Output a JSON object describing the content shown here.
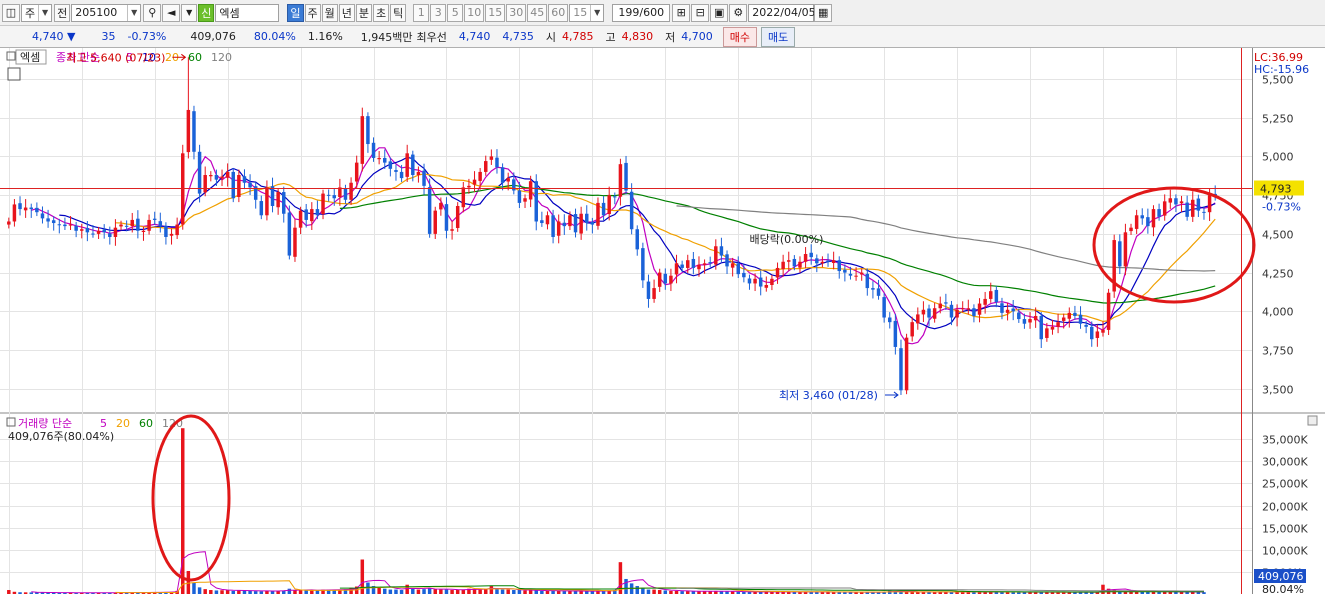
{
  "toolbar": {
    "period_unit": "주",
    "prev_label": "전",
    "stock_code": "205100",
    "stock_badge": "신",
    "stock_name": "엑셈",
    "period_tabs": [
      "일",
      "주",
      "월",
      "년",
      "분",
      "초",
      "틱"
    ],
    "selected_tab": "일",
    "intervals": [
      "1",
      "3",
      "5",
      "10",
      "15",
      "30",
      "45",
      "60"
    ],
    "interval_value": "15",
    "count_display": "199/600",
    "date": "2022/04/05"
  },
  "quote": {
    "price": "4,740",
    "change": "35",
    "change_pct": "-0.73%",
    "volume": "409,076",
    "volume_ratio": "80.04%",
    "turnover": "1.16%",
    "amount": "1,945백만",
    "best_label": "최우선",
    "best_ask": "4,740",
    "best_bid": "4,735",
    "open_label": "시",
    "open": "4,785",
    "high_label": "고",
    "high": "4,830",
    "low_label": "저",
    "low": "4,700",
    "buy_label": "매수",
    "sell_label": "매도"
  },
  "chart_data": {
    "type": "candlestick",
    "price_panel": {
      "indicator_name": "엑셈",
      "legend": {
        "label": "종가 단순",
        "periods": [
          "5",
          "10",
          "20",
          "60",
          "120"
        ],
        "colors": [
          "#c000c0",
          "#0000c0",
          "#f0a000",
          "#008000",
          "#808080"
        ]
      },
      "ylim": [
        3350,
        5700
      ],
      "yticks": [
        "5,500",
        "5,250",
        "5,000",
        "4,750",
        "4,500",
        "4,250",
        "4,000",
        "3,750",
        "3,500"
      ],
      "high_note": "최고 5,640 (07/23)",
      "low_note": "최저 3,460 (01/28)",
      "dividend_note": "배당락(0.00%)",
      "lc_label": "LC:36.99",
      "hc_label": "HC:-15.96",
      "current_price_label": "4,793",
      "current_change_label": "-0.73%",
      "reference_price": 4793,
      "candle_up_color": "#e8141c",
      "candle_down_color": "#1a62d8"
    },
    "volume_panel": {
      "legend": {
        "label": "거래량 단순",
        "periods": [
          "5",
          "20",
          "60",
          "120"
        ],
        "colors": [
          "#c000c0",
          "#f0a000",
          "#008000",
          "#808080"
        ]
      },
      "info": "409,076주(80.04%)",
      "yticks": [
        "35,000K",
        "30,000K",
        "25,000K",
        "20,000K",
        "15,000K",
        "10,000K",
        "5,000K"
      ],
      "ylim_k": [
        0,
        38000
      ],
      "current_volume_label": "409,076",
      "current_ratio_label": "80.04%"
    },
    "closes": [
      4580,
      4690,
      4660,
      4670,
      4660,
      4640,
      4600,
      4580,
      4570,
      4560,
      4550,
      4560,
      4520,
      4530,
      4510,
      4500,
      4520,
      4510,
      4480,
      4540,
      4560,
      4550,
      4590,
      4520,
      4520,
      4590,
      4590,
      4550,
      4480,
      4500,
      4560,
      5020,
      5300,
      5030,
      4760,
      4880,
      4880,
      4850,
      4870,
      4900,
      4730,
      4880,
      4830,
      4800,
      4720,
      4620,
      4800,
      4680,
      4770,
      4630,
      4360,
      4540,
      4650,
      4590,
      4660,
      4620,
      4760,
      4750,
      4730,
      4800,
      4720,
      4830,
      4960,
      5260,
      5080,
      4990,
      4990,
      4960,
      4920,
      4900,
      4860,
      5020,
      4880,
      4900,
      4810,
      4500,
      4650,
      4700,
      4520,
      4530,
      4680,
      4800,
      4810,
      4850,
      4900,
      4970,
      5000,
      4930,
      4830,
      4860,
      4780,
      4700,
      4730,
      4840,
      4580,
      4570,
      4620,
      4480,
      4580,
      4550,
      4620,
      4510,
      4630,
      4570,
      4560,
      4700,
      4620,
      4750,
      4740,
      4950,
      4780,
      4530,
      4400,
      4200,
      4080,
      4150,
      4250,
      4180,
      4230,
      4310,
      4280,
      4330,
      4280,
      4300,
      4310,
      4310,
      4420,
      4360,
      4290,
      4310,
      4240,
      4220,
      4180,
      4210,
      4160,
      4170,
      4210,
      4280,
      4320,
      4330,
      4290,
      4320,
      4370,
      4350,
      4310,
      4320,
      4320,
      4330,
      4260,
      4250,
      4230,
      4230,
      4250,
      4150,
      4140,
      4100,
      3960,
      3930,
      3770,
      3490,
      3830,
      3930,
      3980,
      4010,
      3960,
      4020,
      4050,
      4050,
      3960,
      4010,
      4020,
      4020,
      3970,
      4050,
      4080,
      4130,
      4060,
      3990,
      4010,
      4000,
      3950,
      3920,
      3950,
      3970,
      3820,
      3890,
      3900,
      3930,
      3960,
      3990,
      3970,
      3920,
      3900,
      3820,
      3870,
      3880,
      4120,
      4460,
      4290,
      4510,
      4540,
      4620,
      4600,
      4550,
      4660,
      4610,
      4710,
      4730,
      4690,
      4710,
      4610,
      4720,
      4650,
      4640,
      4750,
      4740
    ],
    "volume_k": [
      900,
      500,
      400,
      380,
      360,
      340,
      330,
      320,
      310,
      300,
      300,
      310,
      290,
      300,
      310,
      290,
      300,
      310,
      300,
      320,
      350,
      330,
      360,
      350,
      310,
      380,
      400,
      420,
      460,
      480,
      700,
      37500,
      5200,
      2500,
      1500,
      1100,
      900,
      800,
      850,
      900,
      700,
      800,
      750,
      700,
      650,
      600,
      750,
      700,
      720,
      800,
      1200,
      900,
      850,
      800,
      900,
      850,
      1000,
      950,
      900,
      1000,
      1100,
      1400,
      1700,
      7800,
      2600,
      1800,
      1500,
      1200,
      1000,
      1000,
      900,
      2100,
      1200,
      1000,
      1100,
      1300,
      1100,
      1000,
      1000,
      900,
      950,
      1000,
      1200,
      1100,
      1000,
      1200,
      1800,
      1100,
      1000,
      1000,
      900,
      900,
      800,
      900,
      800,
      700,
      700,
      700,
      700,
      650,
      700,
      600,
      700,
      650,
      600,
      700,
      700,
      800,
      900,
      7200,
      3400,
      2400,
      1800,
      1400,
      1000,
      1000,
      900,
      800,
      700,
      700,
      650,
      650,
      600,
      600,
      600,
      600,
      700,
      600,
      550,
      550,
      500,
      500,
      480,
      480,
      460,
      460,
      470,
      480,
      490,
      480,
      470,
      480,
      490,
      470,
      460,
      460,
      450,
      440,
      430,
      430,
      430,
      420,
      410,
      400,
      420,
      430,
      450,
      900,
      600,
      500,
      480,
      470,
      460,
      450,
      460,
      460,
      470,
      460,
      450,
      450,
      440,
      440,
      450,
      460,
      470,
      460,
      450,
      450,
      440,
      430,
      440,
      440,
      430,
      430,
      420,
      420,
      420,
      430,
      440,
      430,
      420,
      420,
      410,
      420,
      420,
      2100,
      1200,
      900,
      800,
      700,
      650,
      600,
      600,
      550,
      560,
      540,
      520,
      500,
      480,
      470,
      460,
      450,
      430,
      409
    ]
  }
}
